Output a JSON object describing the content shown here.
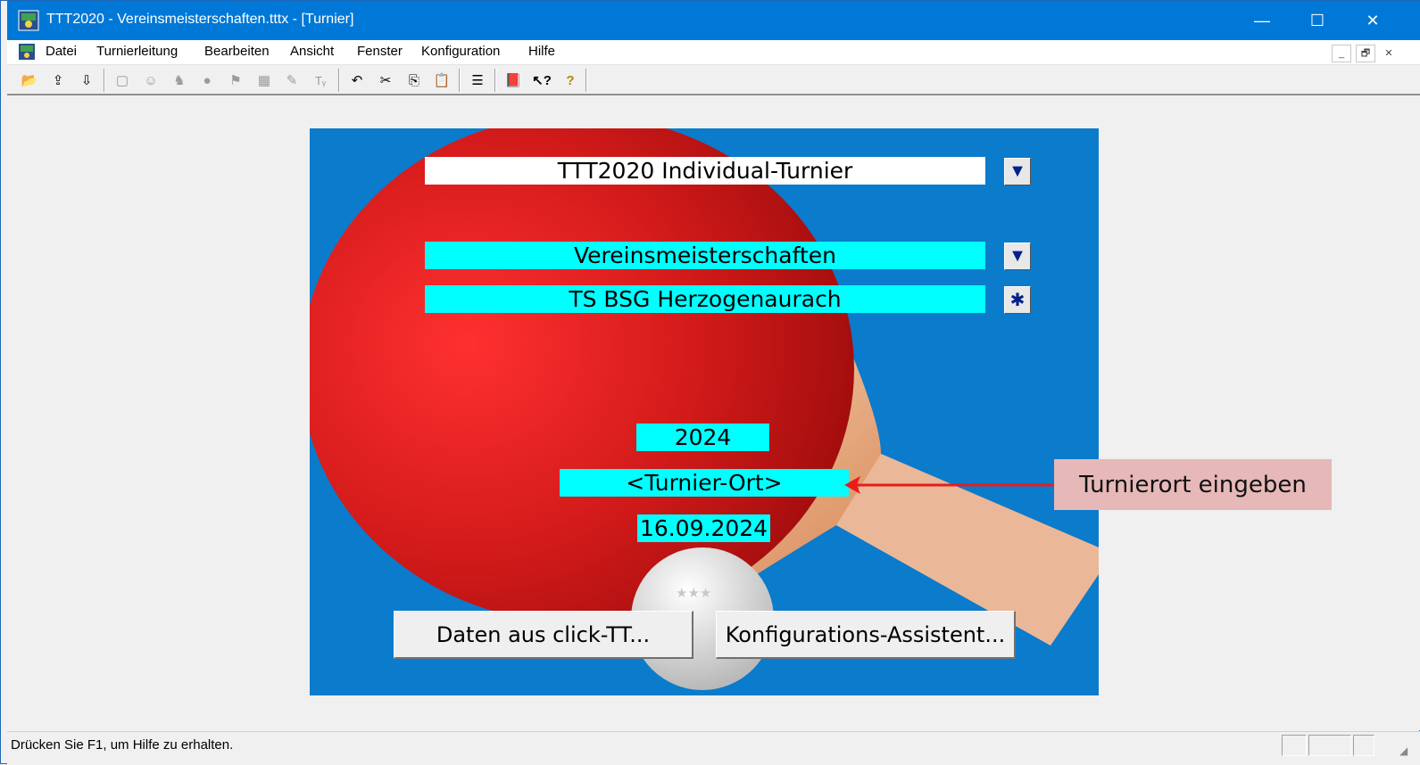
{
  "window": {
    "title": "TTT2020 - Vereinsmeisterschaften.tttx - [Turnier]",
    "minimize": "—",
    "maximize": "☐",
    "close": "✕"
  },
  "menubar": {
    "items": [
      "Datei",
      "Turnierleitung",
      "Bearbeiten",
      "Ansicht",
      "Fenster",
      "Konfiguration",
      "Hilfe"
    ],
    "mdi_minimize": "_",
    "mdi_restore": "🗗",
    "mdi_close": "✕"
  },
  "toolbar": {
    "icons": [
      {
        "name": "open-icon",
        "glyph": "📂"
      },
      {
        "name": "import-icon",
        "glyph": "⇪"
      },
      {
        "name": "export-icon",
        "glyph": "⇩"
      },
      {
        "name": "window-icon",
        "glyph": "▢"
      },
      {
        "name": "players-icon",
        "glyph": "☺"
      },
      {
        "name": "draw-icon",
        "glyph": "♞"
      },
      {
        "name": "ball-icon",
        "glyph": "●"
      },
      {
        "name": "match-icon",
        "glyph": "⚑"
      },
      {
        "name": "plan-icon",
        "glyph": "▦"
      },
      {
        "name": "results-icon",
        "glyph": "✎"
      },
      {
        "name": "text-format-icon",
        "glyph": "Tᵧ"
      },
      {
        "name": "undo-icon",
        "glyph": "↶"
      },
      {
        "name": "cut-icon",
        "glyph": "✂"
      },
      {
        "name": "copy-icon",
        "glyph": "⎘"
      },
      {
        "name": "paste-icon",
        "glyph": "📋"
      },
      {
        "name": "list-icon",
        "glyph": "☰"
      },
      {
        "name": "book-icon",
        "glyph": "📕"
      },
      {
        "name": "context-help-icon",
        "glyph": "↖?"
      },
      {
        "name": "help-icon",
        "glyph": "?"
      }
    ]
  },
  "panel": {
    "tournament_type": "TTT2020 Individual-Turnier",
    "tournament_name": "Vereinsmeisterschaften",
    "club": "TS BSG Herzogenaurach",
    "year": "2024",
    "location": "<Turnier-Ort>",
    "date": "16.09.2024",
    "dropdown_glyph": "▼",
    "asterisk_glyph": "✱",
    "ball_stars": "★★★",
    "clicktt_button": "Daten aus click-TT...",
    "wizard_button": "Konfigurations-Assistent..."
  },
  "annotation": {
    "callout": "Turnierort eingeben",
    "arrow_color": "#e81c1c"
  },
  "statusbar": {
    "text": "Drücken Sie F1, um Hilfe zu erhalten."
  },
  "colors": {
    "titlebar": "#0078d7",
    "panel_bg": "#0b7bcc",
    "field_cyan": "#00ffff",
    "paddle_red": "#d21a1a",
    "callout_bg": "#e6b8b8"
  }
}
